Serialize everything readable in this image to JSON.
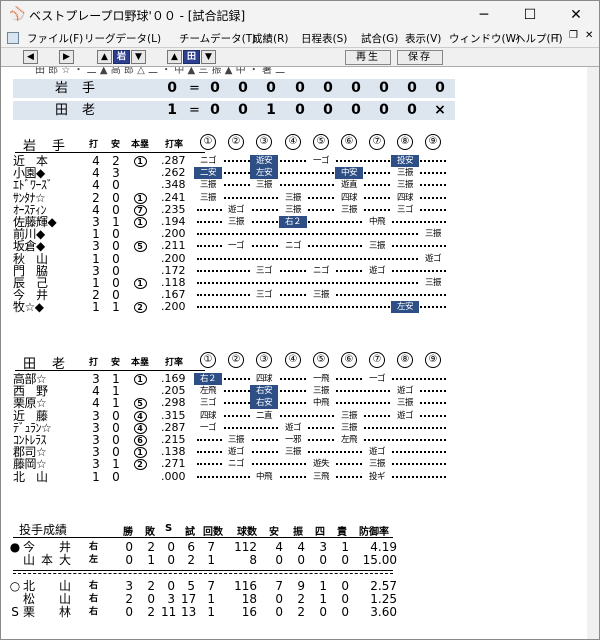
{
  "window": {
    "title": "ベストプレープロ野球'００ - [試合記録]",
    "min": "─",
    "max": "☐",
    "close": "✕"
  },
  "menu": [
    "ファイル(F)",
    "リーグデータ(L)",
    "チームデータ(T)",
    "成績(R)",
    "日程表(S)",
    "試合(G)",
    "表示(V)",
    "ウィンドウ(W)",
    "ヘルプ(H)"
  ],
  "mdi": {
    "min": "─",
    "restore": "❐",
    "close": "✕"
  },
  "toolbar": {
    "left": "◀",
    "right": "▶",
    "up1": "▲",
    "team1": "岩",
    "down1": "▼",
    "up2": "▲",
    "team2": "田",
    "down2": "▼",
    "play": "再生",
    "save": "保存"
  },
  "clip_text": "田 郎 ☆  ・ 二 ▲ 高 郎 △ 二 ・ 中 ▲ 三 振 ▲ 中 ・ 暑 二",
  "linescore": [
    {
      "team": "岩手",
      "total": "0",
      "eq": "=",
      "innings": [
        "0",
        "0",
        "0",
        "0",
        "0",
        "0",
        "0",
        "0",
        "0"
      ]
    },
    {
      "team": "田老",
      "total": "1",
      "eq": "=",
      "innings": [
        "0",
        "0",
        "1",
        "0",
        "0",
        "0",
        "0",
        "0",
        "×"
      ]
    }
  ],
  "headers": {
    "ab": "打",
    "h": "安",
    "hr": "本塁",
    "avg": "打率",
    "innings": [
      "①",
      "②",
      "③",
      "④",
      "⑤",
      "⑥",
      "⑦",
      "⑧",
      "⑨"
    ]
  },
  "batting": [
    {
      "team": "岩手",
      "rows": [
        {
          "name": "近　本",
          "ab": "4",
          "h": "2",
          "hr": "1",
          "avg": ".287",
          "pa": [
            [
              "ニゴ",
              0
            ],
            [
              "",
              0
            ],
            [
              "遊安",
              1
            ],
            [
              "",
              0
            ],
            [
              "一ゴ",
              0
            ],
            [
              "",
              0
            ],
            [
              "",
              0
            ],
            [
              "投安",
              1
            ],
            [
              "",
              0
            ]
          ]
        },
        {
          "name": "小園◆",
          "ab": "4",
          "h": "3",
          "hr": "",
          "avg": ".262",
          "pa": [
            [
              "二安",
              1
            ],
            [
              "",
              0
            ],
            [
              "左安",
              1
            ],
            [
              "",
              0
            ],
            [
              "",
              0
            ],
            [
              "中安",
              1
            ],
            [
              "",
              0
            ],
            [
              "三振",
              0
            ],
            [
              "",
              0
            ]
          ]
        },
        {
          "name": "ｴﾄﾞﾜｰｽﾞ",
          "ab": "4",
          "h": "0",
          "hr": "",
          "avg": ".348",
          "pa": [
            [
              "三振",
              0
            ],
            [
              "",
              0
            ],
            [
              "三振",
              0
            ],
            [
              "",
              0
            ],
            [
              "",
              0
            ],
            [
              "遊直",
              0
            ],
            [
              "",
              0
            ],
            [
              "三振",
              0
            ],
            [
              "",
              0
            ]
          ]
        },
        {
          "name": "ｻﾝﾀﾅ☆",
          "ab": "2",
          "h": "0",
          "hr": "1",
          "avg": ".241",
          "pa": [
            [
              "三振",
              0
            ],
            [
              "",
              0
            ],
            [
              "",
              0
            ],
            [
              "三振",
              0
            ],
            [
              "",
              0
            ],
            [
              "四球",
              0
            ],
            [
              "",
              0
            ],
            [
              "四球",
              0
            ],
            [
              "",
              0
            ]
          ]
        },
        {
          "name": "ｵｰｽﾃｨﾝ",
          "ab": "4",
          "h": "0",
          "hr": "7",
          "avg": ".235",
          "pa": [
            [
              "",
              0
            ],
            [
              "遊ゴ",
              0
            ],
            [
              "",
              0
            ],
            [
              "三振",
              0
            ],
            [
              "",
              0
            ],
            [
              "三振",
              0
            ],
            [
              "",
              0
            ],
            [
              "三ゴ",
              0
            ],
            [
              "",
              0
            ]
          ]
        },
        {
          "name": "佐藤輝◆",
          "ab": "3",
          "h": "1",
          "hr": "1",
          "avg": ".194",
          "pa": [
            [
              "",
              0
            ],
            [
              "三振",
              0
            ],
            [
              "",
              0
            ],
            [
              "右２",
              1
            ],
            [
              "",
              0
            ],
            [
              "",
              0
            ],
            [
              "中飛",
              0
            ],
            [
              "",
              0
            ],
            [
              "",
              0
            ]
          ]
        },
        {
          "name": "前川◆",
          "ab": "1",
          "h": "0",
          "hr": "",
          "avg": ".200",
          "pa": [
            [
              "",
              0
            ],
            [
              "",
              0
            ],
            [
              "",
              0
            ],
            [
              "",
              0
            ],
            [
              "",
              0
            ],
            [
              "",
              0
            ],
            [
              "",
              0
            ],
            [
              "",
              0
            ],
            [
              "三振",
              0
            ]
          ]
        },
        {
          "name": "坂倉◆",
          "ab": "3",
          "h": "0",
          "hr": "5",
          "avg": ".211",
          "pa": [
            [
              "",
              0
            ],
            [
              "一ゴ",
              0
            ],
            [
              "",
              0
            ],
            [
              "ニゴ",
              0
            ],
            [
              "",
              0
            ],
            [
              "",
              0
            ],
            [
              "三振",
              0
            ],
            [
              "",
              0
            ],
            [
              "",
              0
            ]
          ]
        },
        {
          "name": "秋　山",
          "ab": "1",
          "h": "0",
          "hr": "",
          "avg": ".200",
          "pa": [
            [
              "",
              0
            ],
            [
              "",
              0
            ],
            [
              "",
              0
            ],
            [
              "",
              0
            ],
            [
              "",
              0
            ],
            [
              "",
              0
            ],
            [
              "",
              0
            ],
            [
              "",
              0
            ],
            [
              "遊ゴ",
              0
            ]
          ]
        },
        {
          "name": "門　脇",
          "ab": "3",
          "h": "0",
          "hr": "",
          "avg": ".172",
          "pa": [
            [
              "",
              0
            ],
            [
              "",
              0
            ],
            [
              "三ゴ",
              0
            ],
            [
              "",
              0
            ],
            [
              "ニゴ",
              0
            ],
            [
              "",
              0
            ],
            [
              "遊ゴ",
              0
            ],
            [
              "",
              0
            ],
            [
              "",
              0
            ]
          ]
        },
        {
          "name": "辰　己",
          "ab": "1",
          "h": "0",
          "hr": "1",
          "avg": ".118",
          "pa": [
            [
              "",
              0
            ],
            [
              "",
              0
            ],
            [
              "",
              0
            ],
            [
              "",
              0
            ],
            [
              "",
              0
            ],
            [
              "",
              0
            ],
            [
              "",
              0
            ],
            [
              "",
              0
            ],
            [
              "三振",
              0
            ]
          ]
        },
        {
          "name": "今　井",
          "ab": "2",
          "h": "0",
          "hr": "",
          "avg": ".167",
          "pa": [
            [
              "",
              0
            ],
            [
              "",
              0
            ],
            [
              "三ゴ",
              0
            ],
            [
              "",
              0
            ],
            [
              "三振",
              0
            ],
            [
              "",
              0
            ],
            [
              "",
              0
            ],
            [
              "",
              0
            ],
            [
              "",
              0
            ]
          ]
        },
        {
          "name": "牧☆◆",
          "ab": "1",
          "h": "1",
          "hr": "2",
          "avg": ".200",
          "pa": [
            [
              "",
              0
            ],
            [
              "",
              0
            ],
            [
              "",
              0
            ],
            [
              "",
              0
            ],
            [
              "",
              0
            ],
            [
              "",
              0
            ],
            [
              "",
              0
            ],
            [
              "左安",
              1
            ],
            [
              "",
              0
            ]
          ]
        }
      ]
    },
    {
      "team": "田老",
      "rows": [
        {
          "name": "高部☆",
          "ab": "3",
          "h": "1",
          "hr": "1",
          "avg": ".169",
          "pa": [
            [
              "右２",
              1
            ],
            [
              "",
              0
            ],
            [
              "四球",
              0
            ],
            [
              "",
              0
            ],
            [
              "一飛",
              0
            ],
            [
              "",
              0
            ],
            [
              "一ゴ",
              0
            ],
            [
              "",
              0
            ],
            [
              "",
              0
            ]
          ]
        },
        {
          "name": "西　野",
          "ab": "4",
          "h": "1",
          "hr": "",
          "avg": ".205",
          "pa": [
            [
              "左飛",
              0
            ],
            [
              "",
              0
            ],
            [
              "右安",
              1
            ],
            [
              "",
              0
            ],
            [
              "三振",
              0
            ],
            [
              "",
              0
            ],
            [
              "",
              0
            ],
            [
              "遊ゴ",
              0
            ],
            [
              "",
              0
            ]
          ]
        },
        {
          "name": "栗原☆",
          "ab": "4",
          "h": "1",
          "hr": "5",
          "avg": ".298",
          "pa": [
            [
              "三ゴ",
              0
            ],
            [
              "",
              0
            ],
            [
              "右安",
              1
            ],
            [
              "",
              0
            ],
            [
              "中飛",
              0
            ],
            [
              "",
              0
            ],
            [
              "",
              0
            ],
            [
              "三振",
              0
            ],
            [
              "",
              0
            ]
          ]
        },
        {
          "name": "近　藤",
          "ab": "3",
          "h": "0",
          "hr": "4",
          "avg": ".315",
          "pa": [
            [
              "四球",
              0
            ],
            [
              "",
              0
            ],
            [
              "二直",
              0
            ],
            [
              "",
              0
            ],
            [
              "",
              0
            ],
            [
              "三振",
              0
            ],
            [
              "",
              0
            ],
            [
              "遊ゴ",
              0
            ],
            [
              "",
              0
            ]
          ]
        },
        {
          "name": "ﾃﾞｭﾗﾝ☆",
          "ab": "3",
          "h": "0",
          "hr": "4",
          "avg": ".287",
          "pa": [
            [
              "一ゴ",
              0
            ],
            [
              "",
              0
            ],
            [
              "",
              0
            ],
            [
              "遊ゴ",
              0
            ],
            [
              "",
              0
            ],
            [
              "三振",
              0
            ],
            [
              "",
              0
            ],
            [
              "",
              0
            ],
            [
              "",
              0
            ]
          ]
        },
        {
          "name": "ｺﾝﾄﾚﾗｽ",
          "ab": "3",
          "h": "0",
          "hr": "6",
          "avg": ".215",
          "pa": [
            [
              "",
              0
            ],
            [
              "三振",
              0
            ],
            [
              "",
              0
            ],
            [
              "一邪",
              0
            ],
            [
              "",
              0
            ],
            [
              "左飛",
              0
            ],
            [
              "",
              0
            ],
            [
              "",
              0
            ],
            [
              "",
              0
            ]
          ]
        },
        {
          "name": "郡司☆",
          "ab": "3",
          "h": "0",
          "hr": "1",
          "avg": ".138",
          "pa": [
            [
              "",
              0
            ],
            [
              "遊ゴ",
              0
            ],
            [
              "",
              0
            ],
            [
              "三振",
              0
            ],
            [
              "",
              0
            ],
            [
              "",
              0
            ],
            [
              "遊ゴ",
              0
            ],
            [
              "",
              0
            ],
            [
              "",
              0
            ]
          ]
        },
        {
          "name": "藤岡☆",
          "ab": "3",
          "h": "1",
          "hr": "2",
          "avg": ".271",
          "pa": [
            [
              "",
              0
            ],
            [
              "ニゴ",
              0
            ],
            [
              "",
              0
            ],
            [
              "",
              0
            ],
            [
              "遊失",
              0
            ],
            [
              "",
              0
            ],
            [
              "三振",
              0
            ],
            [
              "",
              0
            ],
            [
              "",
              0
            ]
          ]
        },
        {
          "name": "北　山",
          "ab": "1",
          "h": "0",
          "hr": "",
          "avg": ".000",
          "pa": [
            [
              "",
              0
            ],
            [
              "",
              0
            ],
            [
              "中飛",
              0
            ],
            [
              "",
              0
            ],
            [
              "三飛",
              0
            ],
            [
              "",
              0
            ],
            [
              "投ギ",
              0
            ],
            [
              "",
              0
            ],
            [
              "",
              0
            ]
          ]
        }
      ]
    }
  ],
  "pitching": {
    "title": "投手成績",
    "headers": [
      "勝",
      "敗",
      "S",
      "試",
      "回数",
      "球数",
      "安",
      "振",
      "四",
      "責",
      "防御率"
    ],
    "teams": [
      [
        {
          "mark": "●",
          "name": "今　井",
          "lr": "右",
          "w": "0",
          "l": "2",
          "s": "0",
          "g": "6",
          "ip": "7",
          "np": "112",
          "h": "4",
          "so": "4",
          "bb": "3",
          "er": "1",
          "era": "4.19"
        },
        {
          "mark": "",
          "name": "山本大",
          "lr": "左",
          "w": "0",
          "l": "1",
          "s": "0",
          "g": "2",
          "ip": "1",
          "np": "8",
          "h": "0",
          "so": "0",
          "bb": "0",
          "er": "0",
          "era": "15.00"
        }
      ],
      [
        {
          "mark": "○",
          "name": "北　山",
          "lr": "右",
          "w": "3",
          "l": "2",
          "s": "0",
          "g": "5",
          "ip": "7",
          "np": "116",
          "h": "7",
          "so": "9",
          "bb": "1",
          "er": "0",
          "era": "2.57"
        },
        {
          "mark": "",
          "name": "松　山",
          "lr": "右",
          "w": "2",
          "l": "0",
          "s": "3",
          "g": "17",
          "ip": "1",
          "np": "18",
          "h": "0",
          "so": "2",
          "bb": "1",
          "er": "0",
          "era": "1.25"
        },
        {
          "mark": "S",
          "name": "栗　林",
          "lr": "右",
          "w": "0",
          "l": "2",
          "s": "11",
          "g": "13",
          "ip": "1",
          "np": "16",
          "h": "0",
          "so": "2",
          "bb": "0",
          "er": "0",
          "era": "3.60"
        }
      ]
    ]
  },
  "colors": {
    "hit": "#2d4f86",
    "linescore_bg": "#dde5ef"
  }
}
